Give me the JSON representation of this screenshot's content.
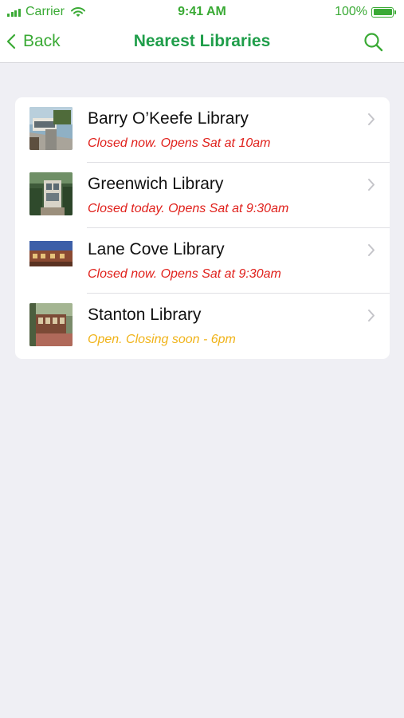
{
  "status_bar": {
    "carrier": "Carrier",
    "time": "9:41 AM",
    "battery": "100%",
    "battery_level": 1.0
  },
  "nav": {
    "back_label": "Back",
    "title": "Nearest Libraries",
    "search_icon": "search-icon"
  },
  "colors": {
    "accent": "#3aaa35",
    "title": "#1f9e4a",
    "closed": "#e0201b",
    "closing_soon": "#f0b319",
    "background": "#efeff4"
  },
  "libraries": [
    {
      "name": "Barry O’Keefe Library",
      "status": "Closed now. Opens Sat at 10am",
      "status_color": "#e0201b"
    },
    {
      "name": "Greenwich Library",
      "status": "Closed today. Opens Sat at 9:30am",
      "status_color": "#e0201b"
    },
    {
      "name": "Lane Cove Library",
      "status": "Closed now. Opens Sat at 9:30am",
      "status_color": "#e0201b"
    },
    {
      "name": "Stanton Library",
      "status": "Open. Closing soon - 6pm",
      "status_color": "#f0b319"
    }
  ]
}
